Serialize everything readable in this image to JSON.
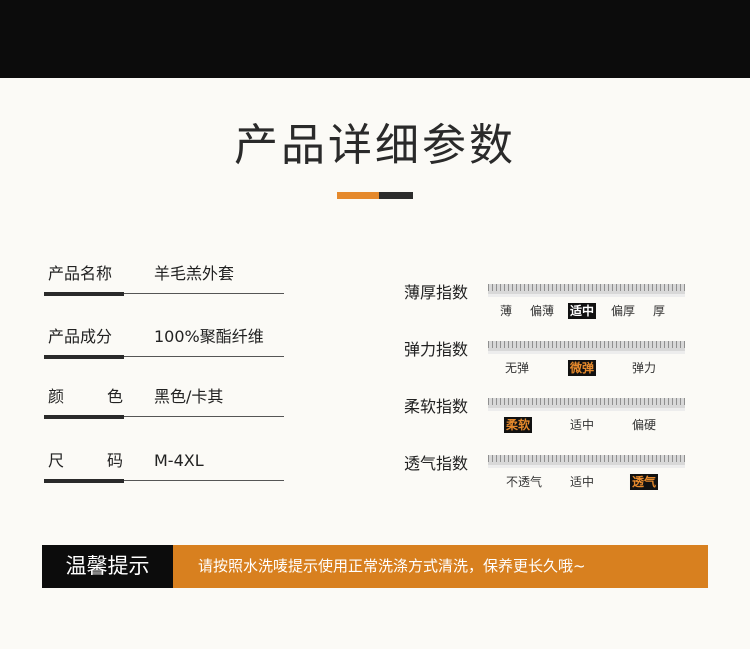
{
  "page": {
    "title": "产品详细参数"
  },
  "specs": [
    {
      "label": "产品名称",
      "value": "羊毛羔外套"
    },
    {
      "label": "产品成分",
      "value": "100%聚酯纤维"
    },
    {
      "label_chars": [
        "颜",
        "色"
      ],
      "value": "黑色/卡其"
    },
    {
      "label_chars": [
        "尺",
        "码"
      ],
      "value": "M-4XL"
    }
  ],
  "indices": [
    {
      "label": "薄厚指数",
      "options": [
        "薄",
        "偏薄",
        "适中",
        "偏厚",
        "厚"
      ],
      "selected": "适中"
    },
    {
      "label": "弹力指数",
      "options": [
        "无弹",
        "微弹",
        "弹力"
      ],
      "selected": "微弹"
    },
    {
      "label": "柔软指数",
      "options": [
        "柔软",
        "适中",
        "偏硬"
      ],
      "selected": "柔软"
    },
    {
      "label": "透气指数",
      "options": [
        "不透气",
        "适中",
        "透气"
      ],
      "selected": "透气"
    }
  ],
  "tip": {
    "label": "温馨提示",
    "text": "请按照水洗唛提示使用正常洗涤方式清洗，保养更长久哦~"
  },
  "colors": {
    "accent": "#e5892c",
    "dark": "#0c0c0c",
    "background": "#fbfaf6"
  }
}
